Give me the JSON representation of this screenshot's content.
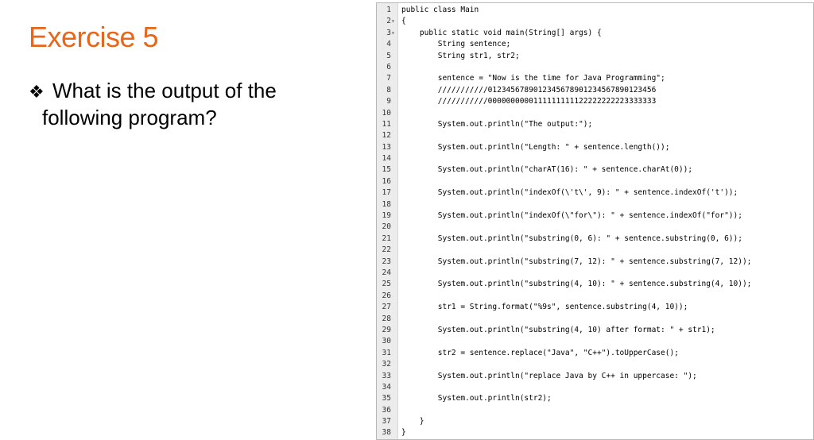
{
  "slide": {
    "title": "Exercise 5",
    "bullet": "❖",
    "question_line1": "What is the output of the",
    "question_line2": "following program?"
  },
  "code": {
    "lines": [
      {
        "n": "1",
        "fold": "",
        "text": "public class Main"
      },
      {
        "n": "2",
        "fold": "▾",
        "text": "{"
      },
      {
        "n": "3",
        "fold": "▾",
        "text": "    public static void main(String[] args) {"
      },
      {
        "n": "4",
        "fold": "",
        "text": "        String sentence;"
      },
      {
        "n": "5",
        "fold": "",
        "text": "        String str1, str2;"
      },
      {
        "n": "6",
        "fold": "",
        "text": ""
      },
      {
        "n": "7",
        "fold": "",
        "text": "        sentence = \"Now is the time for Java Programming\";"
      },
      {
        "n": "8",
        "fold": "",
        "text": "        ///////////0123456789012345678901234567890123456"
      },
      {
        "n": "9",
        "fold": "",
        "text": "        ///////////0000000000111111111122222222223333333"
      },
      {
        "n": "10",
        "fold": "",
        "text": ""
      },
      {
        "n": "11",
        "fold": "",
        "text": "        System.out.println(\"The output:\");"
      },
      {
        "n": "12",
        "fold": "",
        "text": ""
      },
      {
        "n": "13",
        "fold": "",
        "text": "        System.out.println(\"Length: \" + sentence.length());"
      },
      {
        "n": "14",
        "fold": "",
        "text": ""
      },
      {
        "n": "15",
        "fold": "",
        "text": "        System.out.println(\"charAT(16): \" + sentence.charAt(0));"
      },
      {
        "n": "16",
        "fold": "",
        "text": ""
      },
      {
        "n": "17",
        "fold": "",
        "text": "        System.out.println(\"indexOf(\\'t\\', 9): \" + sentence.indexOf('t'));"
      },
      {
        "n": "18",
        "fold": "",
        "text": ""
      },
      {
        "n": "19",
        "fold": "",
        "text": "        System.out.println(\"indexOf(\\\"for\\\"): \" + sentence.indexOf(\"for\"));"
      },
      {
        "n": "20",
        "fold": "",
        "text": ""
      },
      {
        "n": "21",
        "fold": "",
        "text": "        System.out.println(\"substring(0, 6): \" + sentence.substring(0, 6));"
      },
      {
        "n": "22",
        "fold": "",
        "text": ""
      },
      {
        "n": "23",
        "fold": "",
        "text": "        System.out.println(\"substring(7, 12): \" + sentence.substring(7, 12));"
      },
      {
        "n": "24",
        "fold": "",
        "text": ""
      },
      {
        "n": "25",
        "fold": "",
        "text": "        System.out.println(\"substring(4, 10): \" + sentence.substring(4, 10));"
      },
      {
        "n": "26",
        "fold": "",
        "text": ""
      },
      {
        "n": "27",
        "fold": "",
        "text": "        str1 = String.format(\"%9s\", sentence.substring(4, 10));"
      },
      {
        "n": "28",
        "fold": "",
        "text": ""
      },
      {
        "n": "29",
        "fold": "",
        "text": "        System.out.println(\"substring(4, 10) after format: \" + str1);"
      },
      {
        "n": "30",
        "fold": "",
        "text": ""
      },
      {
        "n": "31",
        "fold": "",
        "text": "        str2 = sentence.replace(\"Java\", \"C++\").toUpperCase();"
      },
      {
        "n": "32",
        "fold": "",
        "text": ""
      },
      {
        "n": "33",
        "fold": "",
        "text": "        System.out.println(\"replace Java by C++ in uppercase: \");"
      },
      {
        "n": "34",
        "fold": "",
        "text": ""
      },
      {
        "n": "35",
        "fold": "",
        "text": "        System.out.println(str2);"
      },
      {
        "n": "36",
        "fold": "",
        "text": ""
      },
      {
        "n": "37",
        "fold": "",
        "text": "    }"
      },
      {
        "n": "38",
        "fold": "",
        "text": "}"
      }
    ]
  }
}
